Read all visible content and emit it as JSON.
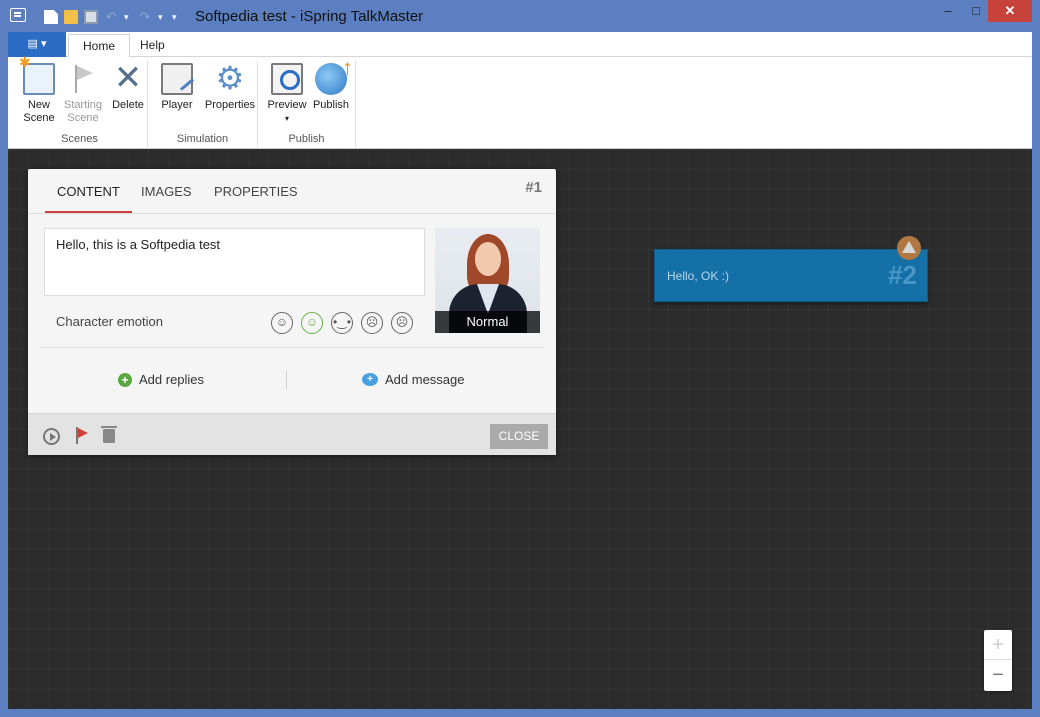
{
  "window": {
    "title": "Softpedia test - iSpring TalkMaster",
    "min": "‒",
    "max": "□",
    "close": "✕"
  },
  "qat": {
    "undo": "↶",
    "redo": "↷",
    "dropdown": "▾"
  },
  "ribbon_tabs": {
    "file": "▤ ▾",
    "home": "Home",
    "help": "Help"
  },
  "ribbon": {
    "scenes": {
      "label": "Scenes",
      "new_scene": "New\nScene",
      "starting_scene": "Starting\nScene",
      "delete": "Delete"
    },
    "simulation": {
      "label": "Simulation",
      "player": "Player",
      "properties": "Properties"
    },
    "publish": {
      "label": "Publish",
      "preview": "Preview",
      "preview_arrow": "▾",
      "publish": "Publish"
    }
  },
  "panel": {
    "tabs": [
      "CONTENT",
      "IMAGES",
      "PROPERTIES"
    ],
    "number": "#1",
    "text": "Hello, this is a Softpedia test",
    "character_label": "Normal",
    "emotion_label": "Character emotion",
    "emotions": [
      "☺",
      "☺",
      "•‿•",
      "☹",
      "☹"
    ],
    "add_replies": "Add replies",
    "add_message": "Add message",
    "close": "CLOSE"
  },
  "scene2": {
    "text": "Hello, OK :)",
    "number": "#2"
  },
  "zoom": {
    "in": "+",
    "out": "−"
  }
}
